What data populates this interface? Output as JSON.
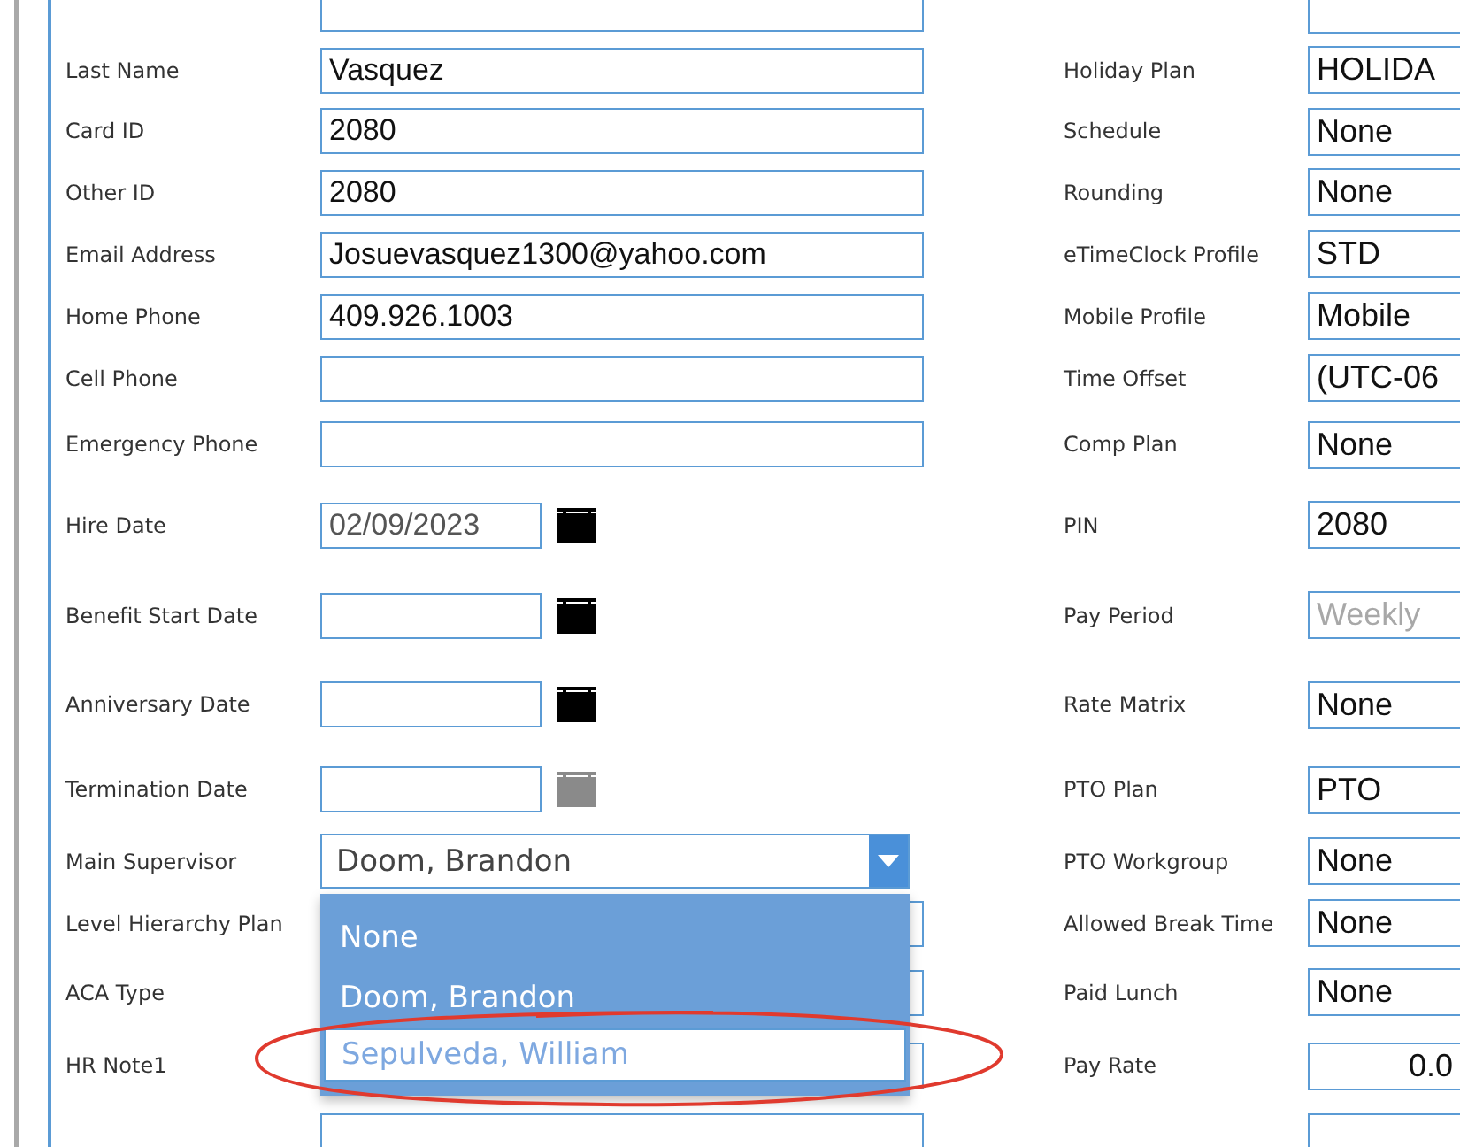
{
  "rows": [
    {
      "left": {
        "kind": "text"
      },
      "right": {
        "kind": "text"
      }
    },
    {
      "left": {
        "kind": "text",
        "label": "Last Name",
        "value": "Vasquez"
      },
      "right": {
        "kind": "text",
        "label": "Holiday Plan",
        "value": "HOLIDA",
        "disabled": false
      }
    },
    {
      "left": {
        "kind": "text",
        "label": "Card ID",
        "value": "2080"
      },
      "right": {
        "kind": "text",
        "label": "Schedule",
        "value": "None",
        "disabled": false
      }
    },
    {
      "left": {
        "kind": "text",
        "label": "Other ID",
        "value": "2080"
      },
      "right": {
        "kind": "text",
        "label": "Rounding",
        "value": "None",
        "disabled": false
      }
    },
    {
      "left": {
        "kind": "text",
        "label": "Email Address",
        "value": "Josuevasquez1300@yahoo.com"
      },
      "right": {
        "kind": "text",
        "label": "eTimeClock Profile",
        "value": "STD",
        "disabled": false
      }
    },
    {
      "left": {
        "kind": "text",
        "label": "Home Phone",
        "value": "409.926.1003"
      },
      "right": {
        "kind": "text",
        "label": "Mobile Profile",
        "value": "Mobile",
        "disabled": false
      }
    },
    {
      "left": {
        "kind": "text",
        "label": "Cell Phone"
      },
      "right": {
        "kind": "text",
        "label": "Time Offset",
        "value": "(UTC-06",
        "disabled": false
      }
    },
    {
      "left": {
        "kind": "text",
        "label": "Emergency Phone"
      },
      "right": {
        "kind": "text",
        "label": "Comp Plan",
        "value": "None",
        "disabled": false
      }
    },
    {
      "left": {
        "kind": "date",
        "label": "Hire Date",
        "value": "02/09/2023",
        "calendar_disabled": false
      },
      "right": {
        "kind": "text",
        "label": "PIN",
        "value": "2080",
        "disabled": false
      }
    },
    {
      "left": {
        "kind": "date",
        "label": "Benefit Start Date",
        "calendar_disabled": false
      },
      "right": {
        "kind": "text",
        "label": "Pay Period",
        "value": "Weekly",
        "disabled": true
      }
    },
    {
      "left": {
        "kind": "date",
        "label": "Anniversary Date",
        "calendar_disabled": false
      },
      "right": {
        "kind": "text",
        "label": "Rate Matrix",
        "value": "None",
        "disabled": false
      }
    },
    {
      "left": {
        "kind": "date",
        "label": "Termination Date",
        "calendar_disabled": true
      },
      "right": {
        "kind": "text",
        "label": "PTO Plan",
        "value": "PTO",
        "disabled": false
      }
    },
    {
      "left": {
        "kind": "select",
        "label": "Main Supervisor",
        "value": "Doom, Brandon",
        "open": true,
        "options": [
          {
            "label": "None",
            "hovered": false
          },
          {
            "label": "Doom, Brandon",
            "hovered": false
          },
          {
            "label": "Sepulveda, William",
            "hovered": true
          }
        ],
        "annotations": [
          {
            "kind": "ellipse"
          }
        ]
      },
      "right": {
        "kind": "text",
        "label": "PTO Workgroup",
        "value": "None",
        "disabled": false
      }
    },
    {
      "left": {
        "kind": "text",
        "label": "Level Hierarchy Plan"
      },
      "right": {
        "kind": "text",
        "label": "Allowed Break Time",
        "value": "None",
        "disabled": false
      }
    },
    {
      "left": {
        "kind": "text",
        "label": "ACA Type"
      },
      "right": {
        "kind": "text",
        "label": "Paid Lunch",
        "value": "None",
        "disabled": false
      }
    },
    {
      "left": {
        "kind": "text",
        "label": "HR Note1"
      },
      "right": {
        "kind": "number",
        "label": "Pay Rate",
        "value": "0.0",
        "disabled": false
      }
    },
    {
      "left": {
        "kind": "text"
      },
      "right": {
        "kind": "number"
      }
    }
  ]
}
